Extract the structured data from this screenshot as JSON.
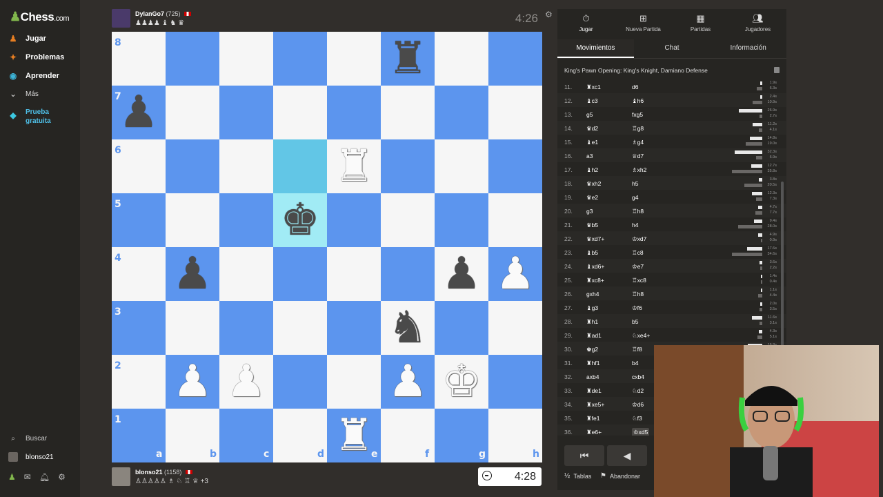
{
  "sidebar": {
    "logo": "Chess",
    "logo_domain": ".com",
    "items": [
      {
        "label": "Jugar",
        "icon": "play-icon",
        "color": "#e67e22"
      },
      {
        "label": "Problemas",
        "icon": "puzzle-icon",
        "color": "#e67e22"
      },
      {
        "label": "Aprender",
        "icon": "learn-icon",
        "color": "#3cb4d8"
      },
      {
        "label": "Más",
        "icon": "chevron-down-icon"
      },
      {
        "label": "Prueba gratuita",
        "icon": "diamond-icon",
        "color": "#3cc8e0"
      }
    ],
    "search_label": "Buscar",
    "username": "blonso21"
  },
  "top_player": {
    "name": "DylanGo7",
    "rating": "(725)",
    "clock": "4:26",
    "captured": "♟♟♟♟ ♝ ♞ ♛"
  },
  "bottom_player": {
    "name": "blonso21",
    "rating": "(1158)",
    "clock": "4:28",
    "captured": "♙♙♙♙♙ ♗ ♘ ♖ ♕",
    "advantage": "+3"
  },
  "board": {
    "colors": {
      "light": "#f6f6f6",
      "dark": "#5c95ee",
      "highlight": "#62c6e6"
    },
    "rank_labels": [
      "8",
      "7",
      "6",
      "5",
      "4",
      "3",
      "2",
      "1"
    ],
    "file_labels": [
      "a",
      "b",
      "c",
      "d",
      "e",
      "f",
      "g",
      "h"
    ],
    "highlighted_squares": [
      "d6",
      "d5"
    ],
    "pieces": [
      {
        "square": "f8",
        "glyph": "♜",
        "color": "b",
        "name": "black-rook"
      },
      {
        "square": "a7",
        "glyph": "♟",
        "color": "b",
        "name": "black-pawn"
      },
      {
        "square": "e6",
        "glyph": "♜",
        "color": "w",
        "name": "white-rook"
      },
      {
        "square": "d5",
        "glyph": "♚",
        "color": "b",
        "name": "black-king"
      },
      {
        "square": "b4",
        "glyph": "♟",
        "color": "b",
        "name": "black-pawn"
      },
      {
        "square": "g4",
        "glyph": "♟",
        "color": "b",
        "name": "black-pawn"
      },
      {
        "square": "h4",
        "glyph": "♟",
        "color": "w",
        "name": "white-pawn"
      },
      {
        "square": "f3",
        "glyph": "♞",
        "color": "b",
        "name": "black-knight"
      },
      {
        "square": "b2",
        "glyph": "♟",
        "color": "w",
        "name": "white-pawn"
      },
      {
        "square": "c2",
        "glyph": "♟",
        "color": "w",
        "name": "white-pawn"
      },
      {
        "square": "f2",
        "glyph": "♟",
        "color": "w",
        "name": "white-pawn"
      },
      {
        "square": "g2",
        "glyph": "♚",
        "color": "w",
        "name": "white-king"
      },
      {
        "square": "e1",
        "glyph": "♜",
        "color": "w",
        "name": "white-rook"
      }
    ]
  },
  "panel": {
    "top_tabs": [
      {
        "label": "Jugar",
        "icon": "timer-icon"
      },
      {
        "label": "Nueva Partida",
        "icon": "plus-icon"
      },
      {
        "label": "Partidas",
        "icon": "board-icon"
      },
      {
        "label": "Jugadores",
        "icon": "players-icon"
      }
    ],
    "sub_tabs": [
      "Movimientos",
      "Chat",
      "Información"
    ],
    "opening": "King's Pawn Opening: King's Knight, Damiano Defense",
    "moves": [
      {
        "n": "11.",
        "w": "♜xc1",
        "b": "d6",
        "tw": "1.9s",
        "tb": "6.3s",
        "fw": 0.06,
        "fb": 0.18
      },
      {
        "n": "12.",
        "w": "♝c3",
        "b": "♝h6",
        "tw": "2.4s",
        "tb": "10.9s",
        "fw": 0.07,
        "fb": 0.31
      },
      {
        "n": "13.",
        "w": "g5",
        "b": "fxg5",
        "tw": "26.9s",
        "tb": "2.7s",
        "fw": 0.77,
        "fb": 0.08
      },
      {
        "n": "14.",
        "w": "♛d2",
        "b": "♖g8",
        "tw": "11.2s",
        "tb": "4.1s",
        "fw": 0.32,
        "fb": 0.12
      },
      {
        "n": "15.",
        "w": "♝e1",
        "b": "♗g4",
        "tw": "14.8s",
        "tb": "19.0s",
        "fw": 0.42,
        "fb": 0.54
      },
      {
        "n": "16.",
        "w": "a3",
        "b": "♕d7",
        "tw": "32.3s",
        "tb": "6.9s",
        "fw": 0.92,
        "fb": 0.2
      },
      {
        "n": "17.",
        "w": "♝h2",
        "b": "♗xh2",
        "tw": "12.7s",
        "tb": "35.8s",
        "fw": 0.36,
        "fb": 1.0
      },
      {
        "n": "18.",
        "w": "♛xh2",
        "b": "h5",
        "tw": "3.8s",
        "tb": "20.5s",
        "fw": 0.11,
        "fb": 0.59
      },
      {
        "n": "19.",
        "w": "♛e2",
        "b": "g4",
        "tw": "12.3s",
        "tb": "7.3s",
        "fw": 0.35,
        "fb": 0.21
      },
      {
        "n": "20.",
        "w": "g3",
        "b": "♖h8",
        "tw": "4.7s",
        "tb": "7.7s",
        "fw": 0.13,
        "fb": 0.22
      },
      {
        "n": "21.",
        "w": "♛b5",
        "b": "h4",
        "tw": "9.4s",
        "tb": "28.0s",
        "fw": 0.27,
        "fb": 0.8
      },
      {
        "n": "22.",
        "w": "♛xd7+",
        "b": "♔xd7",
        "tw": "4.9s",
        "tb": "0.9s",
        "fw": 0.14,
        "fb": 0.03
      },
      {
        "n": "23.",
        "w": "♝b5",
        "b": "♖c8",
        "tw": "17.6s",
        "tb": "34.6s",
        "fw": 0.5,
        "fb": 0.99
      },
      {
        "n": "24.",
        "w": "♝xd6+",
        "b": "♔e7",
        "tw": "3.6s",
        "tb": "2.2s",
        "fw": 0.1,
        "fb": 0.06
      },
      {
        "n": "25.",
        "w": "♜xc8+",
        "b": "♖xc8",
        "tw": "1.4s",
        "tb": "0.4s",
        "fw": 0.04,
        "fb": 0.01
      },
      {
        "n": "26.",
        "w": "gxh4",
        "b": "♖h8",
        "tw": "1.1s",
        "tb": "4.4s",
        "fw": 0.03,
        "fb": 0.13
      },
      {
        "n": "27.",
        "w": "♝g3",
        "b": "♔f6",
        "tw": "2.0s",
        "tb": "3.5s",
        "fw": 0.06,
        "fb": 0.1
      },
      {
        "n": "28.",
        "w": "♜h1",
        "b": "b5",
        "tw": "11.6s",
        "tb": "3.1s",
        "fw": 0.33,
        "fb": 0.09
      },
      {
        "n": "29.",
        "w": "♜ad1",
        "b": "♘xe4+",
        "tw": "4.3s",
        "tb": "5.1s",
        "fw": 0.12,
        "fb": 0.15
      },
      {
        "n": "30.",
        "w": "♚g2",
        "b": "♖f8",
        "tw": "16.8s",
        "tb": "",
        "fw": 0.48,
        "fb": 0
      },
      {
        "n": "31.",
        "w": "♜hf1",
        "b": "b4",
        "tw": "",
        "tb": "",
        "fw": 0,
        "fb": 0
      },
      {
        "n": "32.",
        "w": "axb4",
        "b": "cxb4",
        "tw": "",
        "tb": "",
        "fw": 0,
        "fb": 0
      },
      {
        "n": "33.",
        "w": "♜de1",
        "b": "♘d2",
        "tw": "",
        "tb": "",
        "fw": 0,
        "fb": 0
      },
      {
        "n": "34.",
        "w": "♜xe5+",
        "b": "♔d6",
        "tw": "",
        "tb": "",
        "fw": 0,
        "fb": 0
      },
      {
        "n": "35.",
        "w": "♜fe1",
        "b": "♘f3",
        "tw": "",
        "tb": "",
        "fw": 0,
        "fb": 0
      },
      {
        "n": "36.",
        "w": "♜e6+",
        "b": "♔xd5",
        "tw": "",
        "tb": "",
        "fw": 0,
        "fb": 0
      }
    ],
    "controls": [
      "⏮",
      "◀"
    ],
    "draw_label": "Tablas",
    "resign_label": "Abandonar"
  }
}
